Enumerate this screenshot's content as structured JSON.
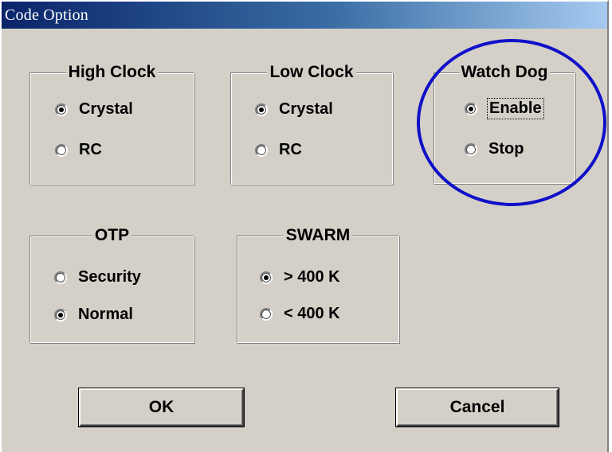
{
  "window": {
    "title": "Code Option"
  },
  "groups": {
    "high_clock": {
      "label": "High Clock",
      "options": [
        "Crystal",
        "RC"
      ],
      "selected": "Crystal"
    },
    "low_clock": {
      "label": "Low Clock",
      "options": [
        "Crystal",
        "RC"
      ],
      "selected": "Crystal"
    },
    "watch_dog": {
      "label": "Watch Dog",
      "options": [
        "Enable",
        "Stop"
      ],
      "selected": "Enable"
    },
    "otp": {
      "label": "OTP",
      "options": [
        "Security",
        "Normal"
      ],
      "selected": "Normal"
    },
    "swarm": {
      "label": "SWARM",
      "options": [
        "> 400 K",
        "< 400 K"
      ],
      "selected": "> 400 K"
    }
  },
  "buttons": {
    "ok": "OK",
    "cancel": "Cancel"
  },
  "annotation": {
    "color": "#1010c8"
  }
}
